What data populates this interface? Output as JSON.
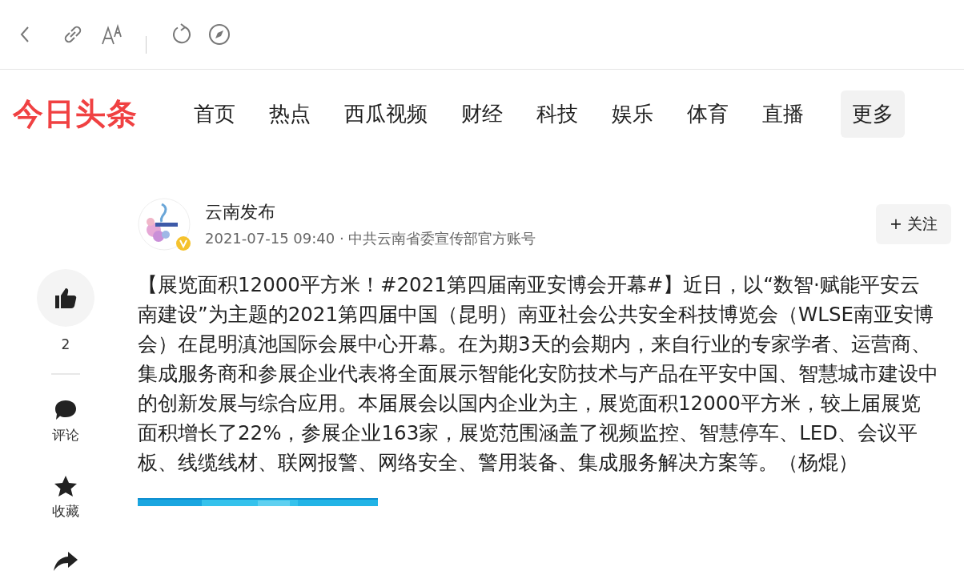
{
  "site": {
    "logo": "今日头条"
  },
  "nav": [
    {
      "label": "首页",
      "selected": false
    },
    {
      "label": "热点",
      "selected": false
    },
    {
      "label": "西瓜视频",
      "selected": false
    },
    {
      "label": "财经",
      "selected": false
    },
    {
      "label": "科技",
      "selected": false
    },
    {
      "label": "娱乐",
      "selected": false
    },
    {
      "label": "体育",
      "selected": false
    },
    {
      "label": "直播",
      "selected": false
    },
    {
      "label": "更多",
      "selected": true
    }
  ],
  "author": {
    "name": "云南发布",
    "meta": "2021-07-15 09:40 · 中共云南省委宣传部官方账号",
    "verified": true,
    "follow": "+ 关注"
  },
  "actions": [
    {
      "kind": "like",
      "label": "2"
    },
    {
      "kind": "comment",
      "label": "评论"
    },
    {
      "kind": "favorite",
      "label": "收藏"
    },
    {
      "kind": "share"
    }
  ],
  "article": {
    "body": "【展览面积12000平方米！#2021第四届南亚安博会开幕#】近日，以“数智·赋能平安云南建设”为主题的2021第四届中国（昆明）南亚社会公共安全科技博览会（WLSE南亚安博会）在昆明滇池国际会展中心开幕。在为期3天的会期内，来自行业的专家学者、运营商、集成服务商和参展企业代表将全面展示智能化安防技术与产品在平安中国、智慧城市建设中的创新发展与综合应用。本届展会以国内企业为主，展览面积12000平方米，较上届展览面积增长了22%，参展企业163家，展览范围涵盖了视频监控、智慧停车、LED、会议平板、线缆线材、联网报警、网络安全、警用装备、集成服务解决方案等。（杨焜）"
  }
}
